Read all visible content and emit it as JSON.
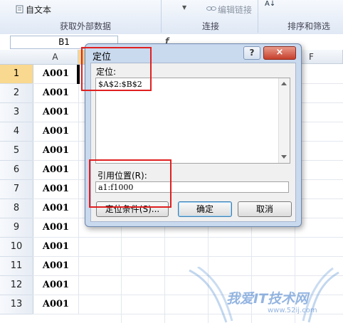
{
  "ribbon": {
    "from_text_label": "自文本",
    "get_external_data_group": "获取外部数据",
    "edit_links_label": "编辑链接",
    "connections_group": "连接",
    "sort_filter_group": "排序和筛选"
  },
  "formula_bar": {
    "name_box": "B1",
    "fx": "f"
  },
  "grid": {
    "column_headers": [
      "A",
      "F"
    ],
    "rows": [
      {
        "num": "1",
        "value": "A001"
      },
      {
        "num": "2",
        "value": "A001"
      },
      {
        "num": "3",
        "value": "A001"
      },
      {
        "num": "4",
        "value": "A001"
      },
      {
        "num": "5",
        "value": "A001"
      },
      {
        "num": "6",
        "value": "A001"
      },
      {
        "num": "7",
        "value": "A001"
      },
      {
        "num": "8",
        "value": "A001"
      },
      {
        "num": "9",
        "value": "A001"
      },
      {
        "num": "10",
        "value": "A001"
      },
      {
        "num": "11",
        "value": "A001"
      },
      {
        "num": "12",
        "value": "A001"
      },
      {
        "num": "13",
        "value": "A001"
      }
    ]
  },
  "dialog": {
    "title": "定位",
    "help": "?",
    "close": "×",
    "goto_label": "定位:",
    "goto_items": [
      "$A$2:$B$2"
    ],
    "reference_label": "引用位置(R):",
    "reference_value": "a1:f1000",
    "special_button": "定位条件(S)...",
    "ok_button": "确定",
    "cancel_button": "取消"
  },
  "watermark": {
    "text": "我爱IT技术网",
    "url": "www.52ij.com"
  },
  "colors": {
    "highlight_red": "#e02020",
    "selected_row_header": "#f9d88f",
    "dialog_frame": "#c9d9ee"
  }
}
